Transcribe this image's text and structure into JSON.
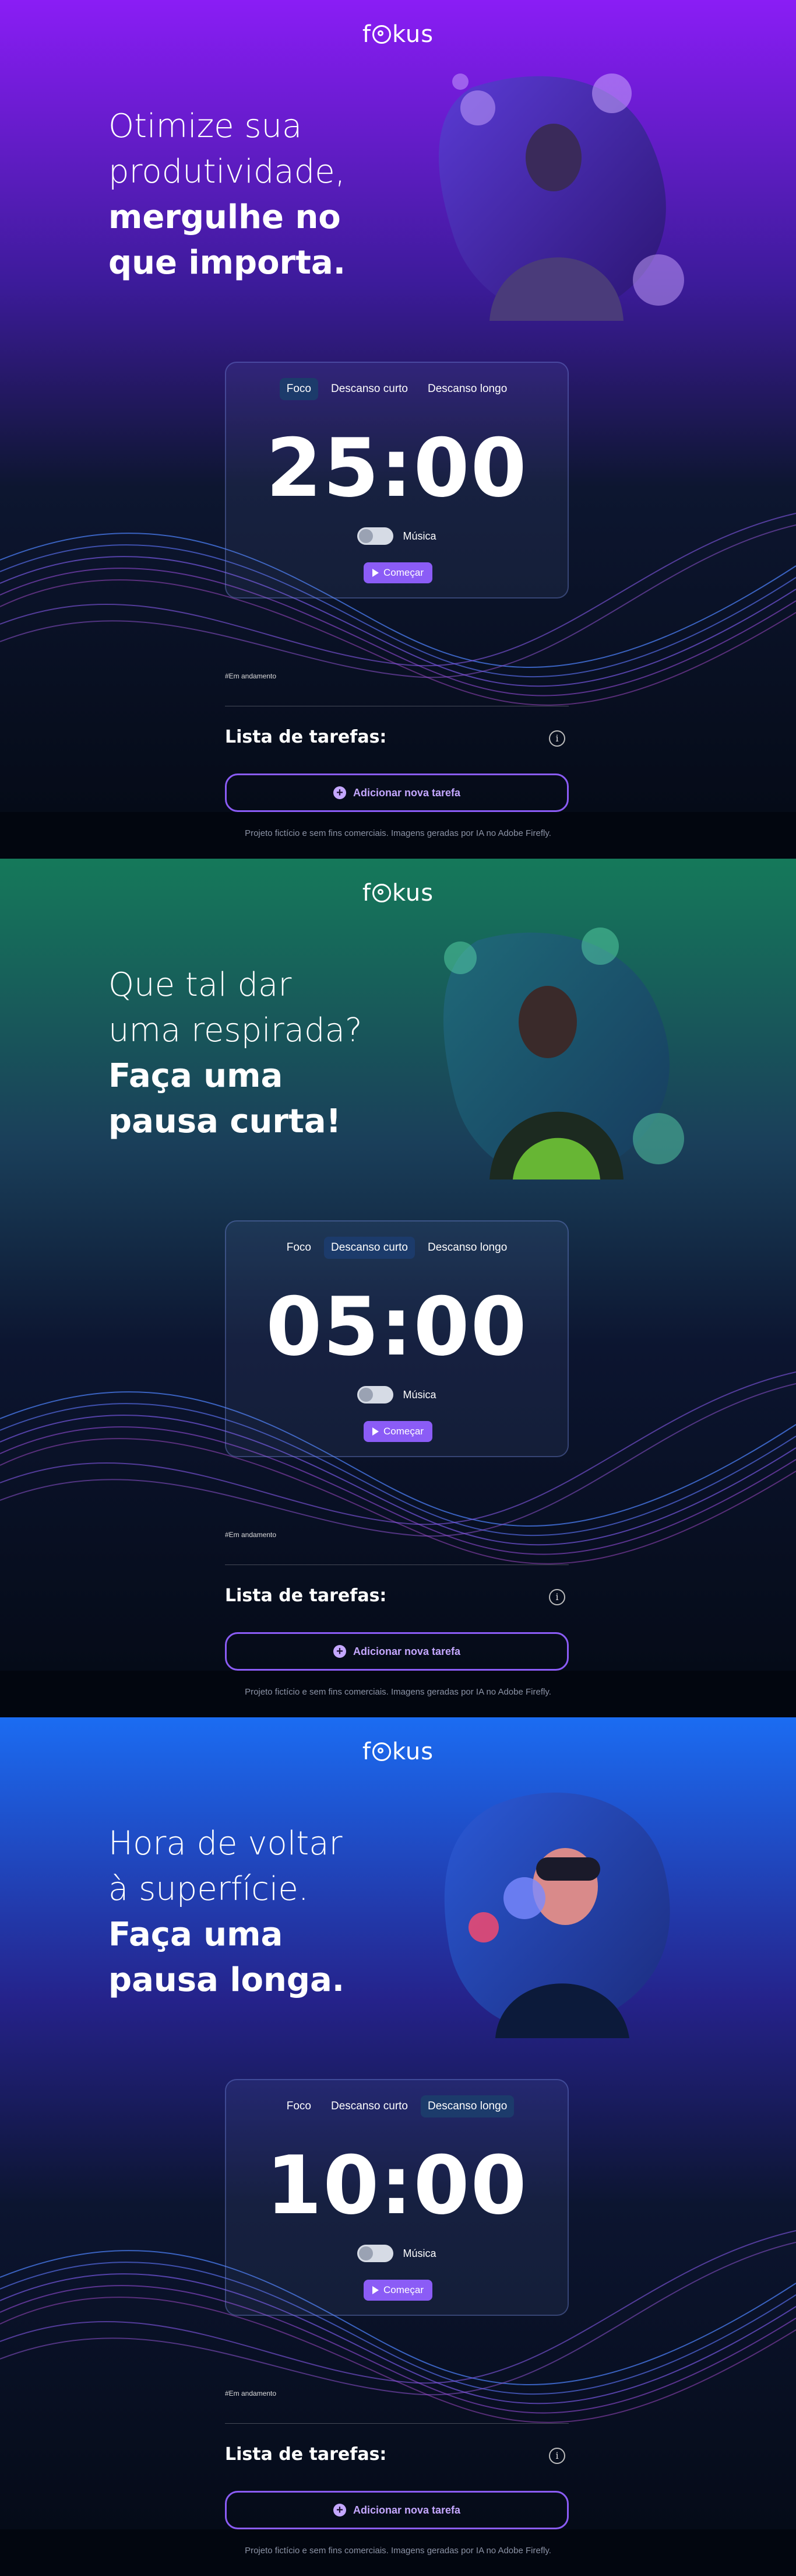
{
  "footer_text": "Projeto fictício e sem fins comerciais. Imagens geradas por IA no Adobe Firefly.",
  "tasks": {
    "in_progress_label": "#Em andamento",
    "title": "Lista de tarefas:",
    "add_label": "Adicionar nova tarefa"
  },
  "tabs": [
    "Foco",
    "Descanso curto",
    "Descanso longo"
  ],
  "music_label": "Música",
  "start_label": "Começar",
  "logo": {
    "prefix": "f",
    "suffix": "kus"
  },
  "screens": [
    {
      "headline_light_1": "Otimize sua",
      "headline_light_2": "produtividade,",
      "headline_bold_1": "mergulhe no",
      "headline_bold_2": "que importa.",
      "timer": "25:00",
      "active_tab": 0,
      "colors": {
        "top": "#8a1df5",
        "mid": "#2a1470",
        "bottom": "#070c1c"
      }
    },
    {
      "headline_light_1": "Que tal dar",
      "headline_light_2": "uma respirada?",
      "headline_bold_1": "Faça uma",
      "headline_bold_2": "pausa curta!",
      "timer": "05:00",
      "active_tab": 1,
      "colors": {
        "top": "#1a7a5a",
        "mid": "#143a52",
        "bottom": "#070c1c"
      }
    },
    {
      "headline_light_1": "Hora de voltar",
      "headline_light_2": "à superfície.",
      "headline_bold_1": "Faça uma",
      "headline_bold_2": "pausa longa.",
      "timer": "10:00",
      "active_tab": 2,
      "colors": {
        "top": "#1b6cf2",
        "mid": "#1b2f82",
        "bottom": "#070c1c"
      }
    }
  ]
}
